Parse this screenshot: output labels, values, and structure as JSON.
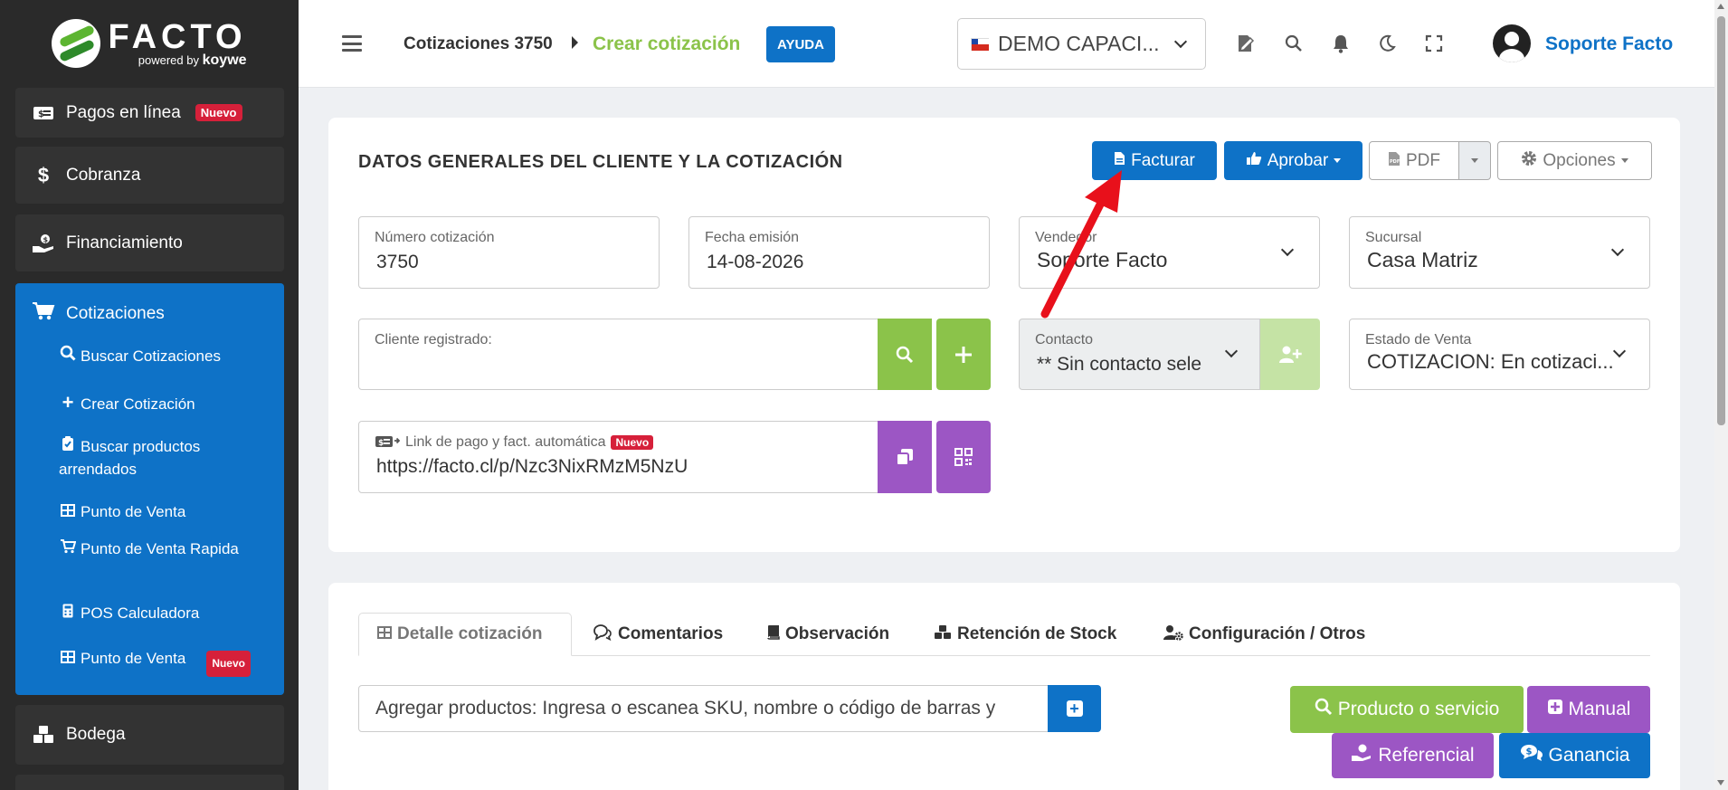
{
  "brand": {
    "name": "FACTO",
    "powered": "powered",
    "by": "by",
    "partner": "koywe"
  },
  "sidebar": {
    "items": [
      {
        "label": "Pagos en línea",
        "badge": "Nuevo",
        "icon": "money-icon"
      },
      {
        "label": "Cobranza",
        "icon": "dollar-icon"
      },
      {
        "label": "Financiamiento",
        "icon": "hand-money-icon"
      }
    ],
    "group": {
      "label": "Cotizaciones",
      "icon": "cart-icon",
      "items": [
        {
          "label": "Buscar Cotizaciones",
          "icon": "search-icon"
        },
        {
          "label": "Crear Cotización",
          "icon": "plus-icon"
        },
        {
          "label": "Buscar productos arrendados",
          "icon": "clipboard-check-icon"
        },
        {
          "label": "Punto de Venta",
          "icon": "grid-icon"
        },
        {
          "label": "Punto de Venta Rapida",
          "icon": "cart-plus-icon"
        },
        {
          "label": "POS Calculadora",
          "icon": "calculator-icon"
        },
        {
          "label": "Punto de Venta",
          "badge": "Nuevo",
          "icon": "grid-icon"
        }
      ]
    },
    "bottom_item": {
      "label": "Bodega",
      "icon": "boxes-icon"
    }
  },
  "header": {
    "breadcrumb": "Cotizaciones 3750",
    "active": "Crear cotización",
    "help": "AYUDA",
    "company": "DEMO CAPACI...",
    "user": "Soporte Facto"
  },
  "card1": {
    "title": "DATOS GENERALES DEL CLIENTE Y LA COTIZACIÓN",
    "buttons": {
      "facturar": "Facturar",
      "aprobar": "Aprobar",
      "pdf": "PDF",
      "opciones": "Opciones"
    },
    "fields": {
      "numero": {
        "label": "Número cotización",
        "value": "3750"
      },
      "fecha": {
        "label": "Fecha emisión",
        "value": "14-08-2026"
      },
      "vendedor": {
        "label": "Vendedor",
        "value": "Soporte Facto"
      },
      "sucursal": {
        "label": "Sucursal",
        "value": "Casa Matriz"
      },
      "cliente": {
        "label": "Cliente registrado:",
        "value": ""
      },
      "contacto": {
        "label": "Contacto",
        "value": "** Sin contacto sele"
      },
      "estado": {
        "label": "Estado de Venta",
        "value": "COTIZACION: En cotizaci..."
      },
      "link": {
        "label": "Link de pago y fact. automática",
        "badge": "Nuevo",
        "value": "https://facto.cl/p/Nzc3NixRMzM5NzU"
      }
    }
  },
  "card2": {
    "tabs": [
      {
        "label": "Detalle cotización",
        "icon": "table-icon"
      },
      {
        "label": "Comentarios",
        "icon": "comments-icon"
      },
      {
        "label": "Observación",
        "icon": "book-icon"
      },
      {
        "label": "Retención de Stock",
        "icon": "cubes-icon"
      },
      {
        "label": "Configuración / Otros",
        "icon": "user-cog-icon"
      }
    ],
    "add_products": "Agregar productos: Ingresa o escanea SKU, nombre o código de barras y",
    "actions": {
      "producto": "Producto o servicio",
      "manual": "Manual",
      "referencial": "Referencial",
      "ganancia": "Ganancia"
    }
  },
  "colors": {
    "primary": "#0e72c7",
    "green": "#8bc34a",
    "purple": "#9c56c4",
    "sidebar": "#2a2a2a",
    "badge": "#d6203a",
    "arrow": "#e8101b"
  }
}
